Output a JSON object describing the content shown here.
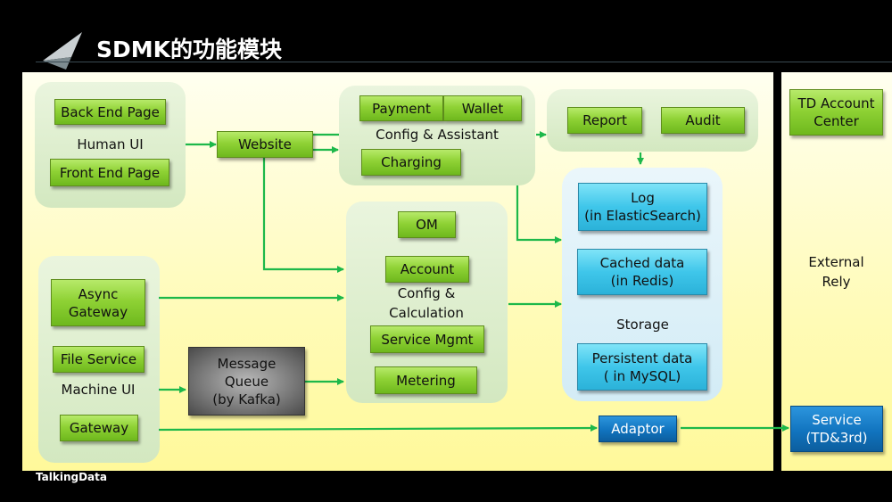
{
  "header": {
    "title": "SDMK的功能模块",
    "logo_icon": "paper-plane-icon"
  },
  "footer": {
    "brand": "TalkingData"
  },
  "human_ui": {
    "label": "Human UI",
    "back_end_page": "Back End Page",
    "front_end_page": "Front End Page"
  },
  "website": "Website",
  "config_assistant": {
    "label": "Config & Assistant",
    "payment": "Payment",
    "wallet": "Wallet",
    "charging": "Charging"
  },
  "report_audit": {
    "report": "Report",
    "audit": "Audit"
  },
  "storage": {
    "label": "Storage",
    "log": "Log\n(in ElasticSearch)",
    "log_line1": "Log",
    "log_line2": "(in ElasticSearch)",
    "cached_line1": "Cached data",
    "cached_line2": "(in Redis)",
    "persistent_line1": "Persistent data",
    "persistent_line2": "( in MySQL)"
  },
  "config_calc": {
    "label_line1": "Config &",
    "label_line2": "Calculation",
    "om": "OM",
    "account": "Account",
    "service_mgmt": "Service Mgmt",
    "metering": "Metering"
  },
  "machine_ui": {
    "label": "Machine UI",
    "async_gateway_line1": "Async",
    "async_gateway_line2": "Gateway",
    "file_service": "File Service",
    "gateway": "Gateway"
  },
  "message_queue": {
    "line1": "Message",
    "line2": "Queue",
    "line3": "(by Kafka)"
  },
  "adaptor": "Adaptor",
  "external": {
    "label_line1": "External",
    "label_line2": "Rely",
    "td_account_line1": "TD Account",
    "td_account_line2": "Center",
    "service_line1": "Service",
    "service_line2": "(TD&3rd)"
  },
  "colors": {
    "arrow": "#1db84a",
    "green_box": "#8fd235",
    "blue_box": "#3fc6ea",
    "dark_blue_box": "#1174bf",
    "panel": "#fffbb8"
  }
}
